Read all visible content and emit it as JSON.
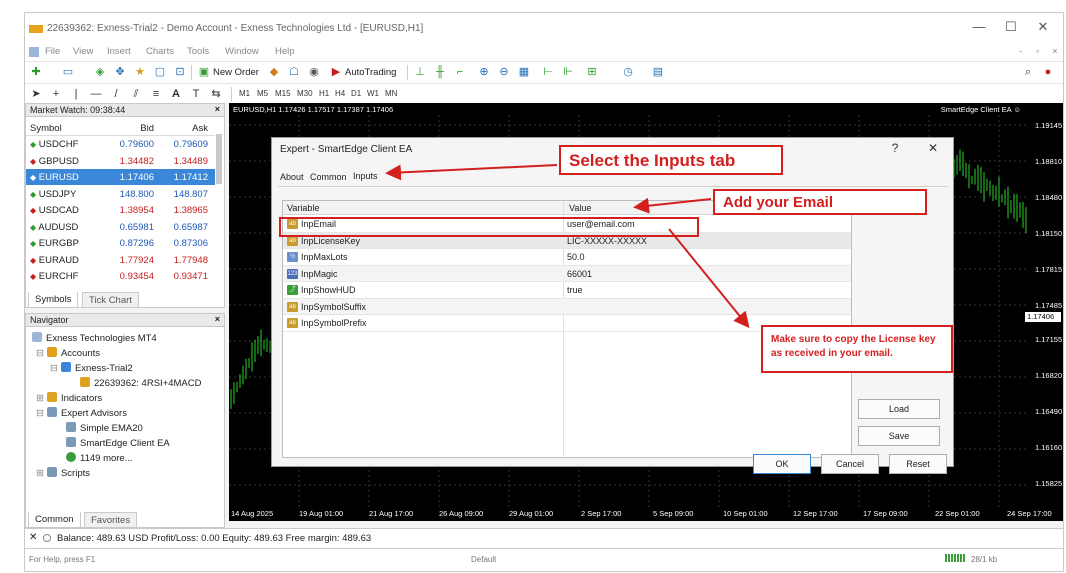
{
  "window": {
    "title": "22639362: Exness-Trial2 - Demo Account - Exness Technologies Ltd - [EURUSD,H1]",
    "min": "—",
    "max": "☐",
    "close": "✕",
    "min2": "-",
    "max2": "▫",
    "close2": "×"
  },
  "menu": [
    "File",
    "View",
    "Insert",
    "Charts",
    "Tools",
    "Window",
    "Help"
  ],
  "toolbar": {
    "new_order": "New Order",
    "autotrading": "AutoTrading"
  },
  "timeframes": [
    "M1",
    "M5",
    "M15",
    "M30",
    "H1",
    "H4",
    "D1",
    "W1",
    "MN"
  ],
  "market_watch": {
    "title": "Market Watch: 09:38:44",
    "columns": [
      "Symbol",
      "Bid",
      "Ask"
    ],
    "rows": [
      {
        "symbol": "USDCHF",
        "bid": "0.79600",
        "ask": "0.79609",
        "dir": "up"
      },
      {
        "symbol": "GBPUSD",
        "bid": "1.34482",
        "ask": "1.34489",
        "dir": "down"
      },
      {
        "symbol": "EURUSD",
        "bid": "1.17406",
        "ask": "1.17412",
        "dir": "down",
        "selected": true
      },
      {
        "symbol": "USDJPY",
        "bid": "148.800",
        "ask": "148.807",
        "dir": "up"
      },
      {
        "symbol": "USDCAD",
        "bid": "1.38954",
        "ask": "1.38965",
        "dir": "down"
      },
      {
        "symbol": "AUDUSD",
        "bid": "0.65981",
        "ask": "0.65987",
        "dir": "up"
      },
      {
        "symbol": "EURGBP",
        "bid": "0.87296",
        "ask": "0.87306",
        "dir": "up"
      },
      {
        "symbol": "EURAUD",
        "bid": "1.77924",
        "ask": "1.77948",
        "dir": "down"
      },
      {
        "symbol": "EURCHF",
        "bid": "0.93454",
        "ask": "0.93471",
        "dir": "down"
      }
    ],
    "tabs": [
      "Symbols",
      "Tick Chart"
    ]
  },
  "navigator": {
    "title": "Navigator",
    "items": [
      "Exness Technologies MT4",
      "Accounts",
      "Exness-Trial2",
      "22639362: 4RSI+4MACD",
      "Indicators",
      "Expert Advisors",
      "Simple EMA20",
      "SmartEdge Client EA",
      "1149 more...",
      "Scripts"
    ],
    "tabs": [
      "Common",
      "Favorites"
    ]
  },
  "chart": {
    "header": "EURUSD,H1  1.17426 1.17517 1.17387 1.17406",
    "ea_label": "SmartEdge Client EA ☺",
    "price_labels": [
      "1.19145",
      "1.18810",
      "1.18480",
      "1.18150",
      "1.17815",
      "1.17485",
      "1.17155",
      "1.16820",
      "1.16490",
      "1.16160",
      "1.15825"
    ],
    "current_price": "1.17406",
    "time_labels": [
      "14 Aug 2025",
      "19 Aug 01:00",
      "21 Aug 17:00",
      "26 Aug 09:00",
      "29 Aug 01:00",
      "2 Sep 17:00",
      "5 Sep 09:00",
      "10 Sep 01:00",
      "12 Sep 17:00",
      "17 Sep 09:00",
      "22 Sep 01:00",
      "24 Sep 17:00"
    ]
  },
  "dialog": {
    "title": "Expert - SmartEdge Client EA",
    "help": "?",
    "close": "✕",
    "tabs": [
      "About",
      "Common",
      "Inputs"
    ],
    "columns": [
      "Variable",
      "Value"
    ],
    "rows": [
      {
        "icon": "ab",
        "color": "#c99a2e",
        "name": "InpEmail",
        "value": "user@email.com"
      },
      {
        "icon": "ab",
        "color": "#c99a2e",
        "name": "InpLicenseKey",
        "value": "LIC-XXXXX-XXXXX"
      },
      {
        "icon": "½",
        "color": "#6a8fc9",
        "name": "InpMaxLots",
        "value": "50.0"
      },
      {
        "icon": "123",
        "color": "#4a6fb8",
        "name": "InpMagic",
        "value": "66001"
      },
      {
        "icon": "⤴",
        "color": "#3b9c3b",
        "name": "InpShowHUD",
        "value": "true"
      },
      {
        "icon": "ab",
        "color": "#c99a2e",
        "name": "InpSymbolSuffix",
        "value": ""
      },
      {
        "icon": "ab",
        "color": "#c99a2e",
        "name": "InpSymbolPrefix",
        "value": ""
      }
    ],
    "buttons": {
      "load": "Load",
      "save": "Save",
      "ok": "OK",
      "cancel": "Cancel",
      "reset": "Reset"
    }
  },
  "annotations": {
    "inputs_tab": "Select the Inputs tab",
    "email": "Add your Email",
    "license": "Make sure to copy the License key as received in your email."
  },
  "status": {
    "balance": "Balance: 489.63 USD  Profit/Loss: 0.00  Equity: 489.63  Free margin: 489.63",
    "help": "For Help, press F1",
    "default": "Default",
    "traffic": "28/1 kb"
  },
  "colors": {
    "annotation": "#d41f1f",
    "selected": "#3a86d8",
    "chart_bg": "#000000",
    "candles": "#2bd12b"
  }
}
